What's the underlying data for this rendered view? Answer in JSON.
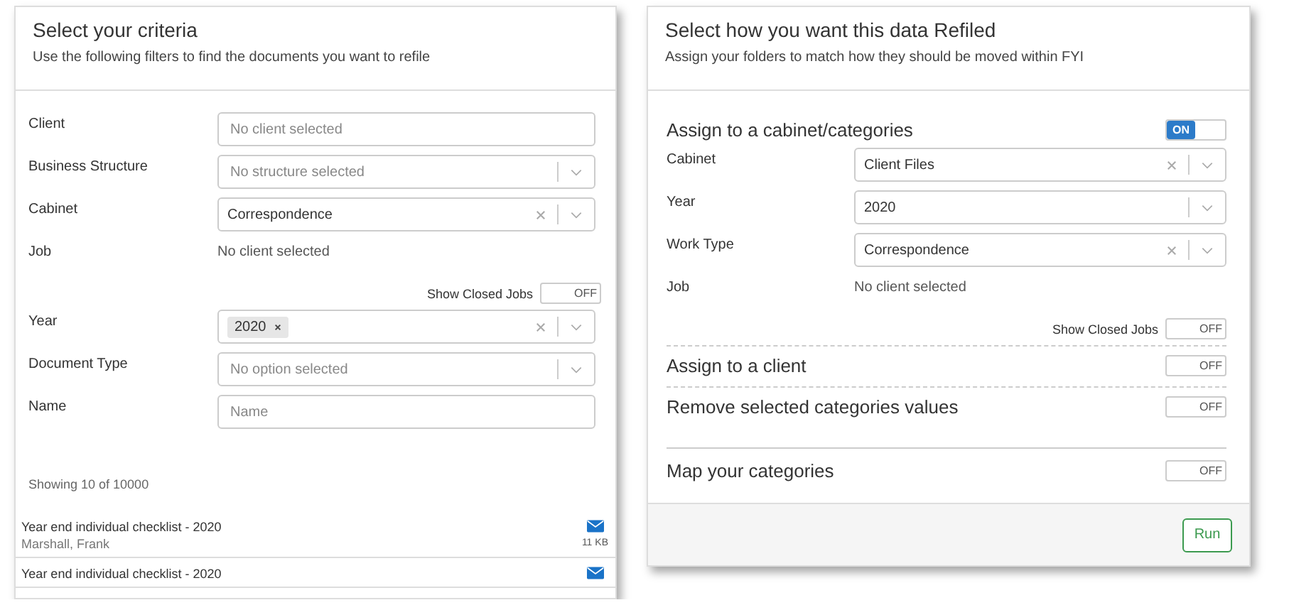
{
  "criteria": {
    "title": "Select your criteria",
    "subtitle": "Use the following filters to find the documents you want to refile",
    "fields": [
      {
        "kind": "input",
        "label": "Client",
        "placeholder": "No client selected"
      },
      {
        "kind": "select",
        "label": "Business Structure",
        "placeholder": "No structure selected",
        "clearable": false
      },
      {
        "kind": "select",
        "label": "Cabinet",
        "value": "Correspondence",
        "clearable": true
      },
      {
        "kind": "text",
        "label": "Job",
        "value": "No client selected"
      },
      {
        "kind": "toggle",
        "label": "Show Closed Jobs",
        "on": false,
        "state_label": "OFF"
      },
      {
        "kind": "tags",
        "label": "Year",
        "tags": [
          "2020"
        ],
        "clearable": true
      },
      {
        "kind": "select",
        "label": "Document Type",
        "placeholder": "No option selected",
        "clearable": false
      },
      {
        "kind": "input",
        "label": "Name",
        "placeholder": "Name"
      }
    ],
    "count": "Showing 10 of 10000",
    "documents": [
      {
        "title": "Year end individual checklist - 2020",
        "client": "Marshall, Frank",
        "size": "11 KB"
      },
      {
        "title": "Year end individual checklist - 2020"
      }
    ]
  },
  "refile": {
    "title": "Select how you want this data Refiled",
    "subtitle": "Assign your folders to match how they should be moved within FYI",
    "sections": [
      {
        "kind": "first",
        "title": "Assign to a cabinet/categories",
        "on": true,
        "state_label": "ON",
        "fields": [
          {
            "kind": "select",
            "label": "Cabinet",
            "value": "Client Files",
            "clearable": true
          },
          {
            "kind": "select",
            "label": "Year",
            "value": "2020",
            "clearable": false
          },
          {
            "kind": "select",
            "label": "Work Type",
            "value": "Correspondence",
            "clearable": true
          },
          {
            "kind": "text",
            "label": "Job",
            "value": "No client selected"
          },
          {
            "kind": "toggle",
            "label": "Show Closed Jobs",
            "on": false,
            "state_label": "OFF"
          }
        ]
      },
      {
        "kind": "dashed",
        "title": "Assign to a client",
        "on": false,
        "state_label": "OFF"
      },
      {
        "kind": "dashed",
        "title": "Remove selected categories values",
        "on": false,
        "state_label": "OFF"
      },
      {
        "kind": "solid",
        "title": "Map your categories",
        "on": false,
        "state_label": "OFF"
      }
    ],
    "run_button": "Run"
  }
}
